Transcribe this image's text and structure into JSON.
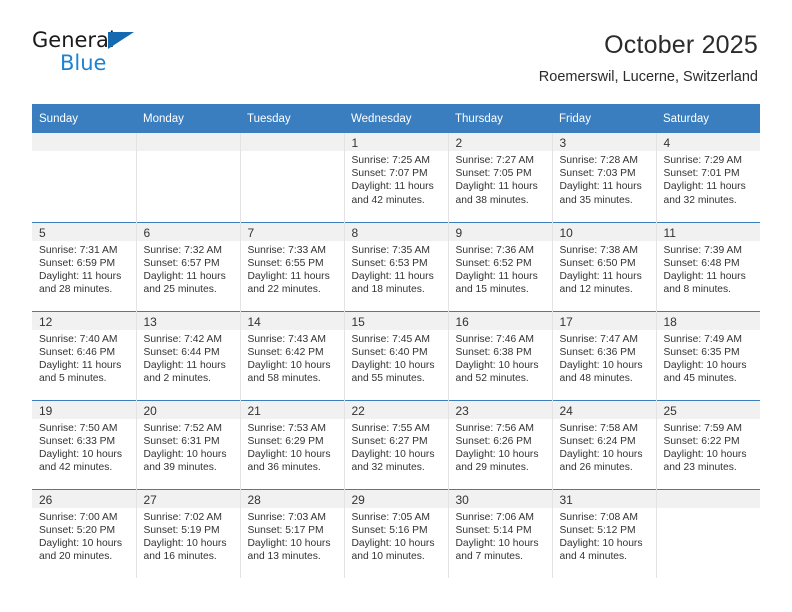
{
  "brand": {
    "name_top": "General",
    "name_bottom": "Blue",
    "accent_color": "#1e82d2",
    "triangle_color": "#1569b0"
  },
  "header": {
    "title": "October 2025",
    "subtitle": "Roemerswil, Lucerne, Switzerland"
  },
  "calendar": {
    "header_bg": "#3a7ebf",
    "header_text_color": "#ffffff",
    "daynum_band_bg": "#f1f1f1",
    "weekday_headers": [
      "Sunday",
      "Monday",
      "Tuesday",
      "Wednesday",
      "Thursday",
      "Friday",
      "Saturday"
    ],
    "weeks": [
      [
        {
          "day": "",
          "empty": true
        },
        {
          "day": "",
          "empty": true
        },
        {
          "day": "",
          "empty": true
        },
        {
          "day": "1",
          "sunrise": "Sunrise: 7:25 AM",
          "sunset": "Sunset: 7:07 PM",
          "daylight_1": "Daylight: 11 hours",
          "daylight_2": "and 42 minutes."
        },
        {
          "day": "2",
          "sunrise": "Sunrise: 7:27 AM",
          "sunset": "Sunset: 7:05 PM",
          "daylight_1": "Daylight: 11 hours",
          "daylight_2": "and 38 minutes."
        },
        {
          "day": "3",
          "sunrise": "Sunrise: 7:28 AM",
          "sunset": "Sunset: 7:03 PM",
          "daylight_1": "Daylight: 11 hours",
          "daylight_2": "and 35 minutes."
        },
        {
          "day": "4",
          "sunrise": "Sunrise: 7:29 AM",
          "sunset": "Sunset: 7:01 PM",
          "daylight_1": "Daylight: 11 hours",
          "daylight_2": "and 32 minutes."
        }
      ],
      [
        {
          "day": "5",
          "sunrise": "Sunrise: 7:31 AM",
          "sunset": "Sunset: 6:59 PM",
          "daylight_1": "Daylight: 11 hours",
          "daylight_2": "and 28 minutes."
        },
        {
          "day": "6",
          "sunrise": "Sunrise: 7:32 AM",
          "sunset": "Sunset: 6:57 PM",
          "daylight_1": "Daylight: 11 hours",
          "daylight_2": "and 25 minutes."
        },
        {
          "day": "7",
          "sunrise": "Sunrise: 7:33 AM",
          "sunset": "Sunset: 6:55 PM",
          "daylight_1": "Daylight: 11 hours",
          "daylight_2": "and 22 minutes."
        },
        {
          "day": "8",
          "sunrise": "Sunrise: 7:35 AM",
          "sunset": "Sunset: 6:53 PM",
          "daylight_1": "Daylight: 11 hours",
          "daylight_2": "and 18 minutes."
        },
        {
          "day": "9",
          "sunrise": "Sunrise: 7:36 AM",
          "sunset": "Sunset: 6:52 PM",
          "daylight_1": "Daylight: 11 hours",
          "daylight_2": "and 15 minutes."
        },
        {
          "day": "10",
          "sunrise": "Sunrise: 7:38 AM",
          "sunset": "Sunset: 6:50 PM",
          "daylight_1": "Daylight: 11 hours",
          "daylight_2": "and 12 minutes."
        },
        {
          "day": "11",
          "sunrise": "Sunrise: 7:39 AM",
          "sunset": "Sunset: 6:48 PM",
          "daylight_1": "Daylight: 11 hours",
          "daylight_2": "and 8 minutes."
        }
      ],
      [
        {
          "day": "12",
          "sunrise": "Sunrise: 7:40 AM",
          "sunset": "Sunset: 6:46 PM",
          "daylight_1": "Daylight: 11 hours",
          "daylight_2": "and 5 minutes."
        },
        {
          "day": "13",
          "sunrise": "Sunrise: 7:42 AM",
          "sunset": "Sunset: 6:44 PM",
          "daylight_1": "Daylight: 11 hours",
          "daylight_2": "and 2 minutes."
        },
        {
          "day": "14",
          "sunrise": "Sunrise: 7:43 AM",
          "sunset": "Sunset: 6:42 PM",
          "daylight_1": "Daylight: 10 hours",
          "daylight_2": "and 58 minutes."
        },
        {
          "day": "15",
          "sunrise": "Sunrise: 7:45 AM",
          "sunset": "Sunset: 6:40 PM",
          "daylight_1": "Daylight: 10 hours",
          "daylight_2": "and 55 minutes."
        },
        {
          "day": "16",
          "sunrise": "Sunrise: 7:46 AM",
          "sunset": "Sunset: 6:38 PM",
          "daylight_1": "Daylight: 10 hours",
          "daylight_2": "and 52 minutes."
        },
        {
          "day": "17",
          "sunrise": "Sunrise: 7:47 AM",
          "sunset": "Sunset: 6:36 PM",
          "daylight_1": "Daylight: 10 hours",
          "daylight_2": "and 48 minutes."
        },
        {
          "day": "18",
          "sunrise": "Sunrise: 7:49 AM",
          "sunset": "Sunset: 6:35 PM",
          "daylight_1": "Daylight: 10 hours",
          "daylight_2": "and 45 minutes."
        }
      ],
      [
        {
          "day": "19",
          "sunrise": "Sunrise: 7:50 AM",
          "sunset": "Sunset: 6:33 PM",
          "daylight_1": "Daylight: 10 hours",
          "daylight_2": "and 42 minutes."
        },
        {
          "day": "20",
          "sunrise": "Sunrise: 7:52 AM",
          "sunset": "Sunset: 6:31 PM",
          "daylight_1": "Daylight: 10 hours",
          "daylight_2": "and 39 minutes."
        },
        {
          "day": "21",
          "sunrise": "Sunrise: 7:53 AM",
          "sunset": "Sunset: 6:29 PM",
          "daylight_1": "Daylight: 10 hours",
          "daylight_2": "and 36 minutes."
        },
        {
          "day": "22",
          "sunrise": "Sunrise: 7:55 AM",
          "sunset": "Sunset: 6:27 PM",
          "daylight_1": "Daylight: 10 hours",
          "daylight_2": "and 32 minutes."
        },
        {
          "day": "23",
          "sunrise": "Sunrise: 7:56 AM",
          "sunset": "Sunset: 6:26 PM",
          "daylight_1": "Daylight: 10 hours",
          "daylight_2": "and 29 minutes."
        },
        {
          "day": "24",
          "sunrise": "Sunrise: 7:58 AM",
          "sunset": "Sunset: 6:24 PM",
          "daylight_1": "Daylight: 10 hours",
          "daylight_2": "and 26 minutes."
        },
        {
          "day": "25",
          "sunrise": "Sunrise: 7:59 AM",
          "sunset": "Sunset: 6:22 PM",
          "daylight_1": "Daylight: 10 hours",
          "daylight_2": "and 23 minutes."
        }
      ],
      [
        {
          "day": "26",
          "sunrise": "Sunrise: 7:00 AM",
          "sunset": "Sunset: 5:20 PM",
          "daylight_1": "Daylight: 10 hours",
          "daylight_2": "and 20 minutes."
        },
        {
          "day": "27",
          "sunrise": "Sunrise: 7:02 AM",
          "sunset": "Sunset: 5:19 PM",
          "daylight_1": "Daylight: 10 hours",
          "daylight_2": "and 16 minutes."
        },
        {
          "day": "28",
          "sunrise": "Sunrise: 7:03 AM",
          "sunset": "Sunset: 5:17 PM",
          "daylight_1": "Daylight: 10 hours",
          "daylight_2": "and 13 minutes."
        },
        {
          "day": "29",
          "sunrise": "Sunrise: 7:05 AM",
          "sunset": "Sunset: 5:16 PM",
          "daylight_1": "Daylight: 10 hours",
          "daylight_2": "and 10 minutes."
        },
        {
          "day": "30",
          "sunrise": "Sunrise: 7:06 AM",
          "sunset": "Sunset: 5:14 PM",
          "daylight_1": "Daylight: 10 hours",
          "daylight_2": "and 7 minutes."
        },
        {
          "day": "31",
          "sunrise": "Sunrise: 7:08 AM",
          "sunset": "Sunset: 5:12 PM",
          "daylight_1": "Daylight: 10 hours",
          "daylight_2": "and 4 minutes."
        },
        {
          "day": "",
          "empty": true
        }
      ]
    ]
  }
}
